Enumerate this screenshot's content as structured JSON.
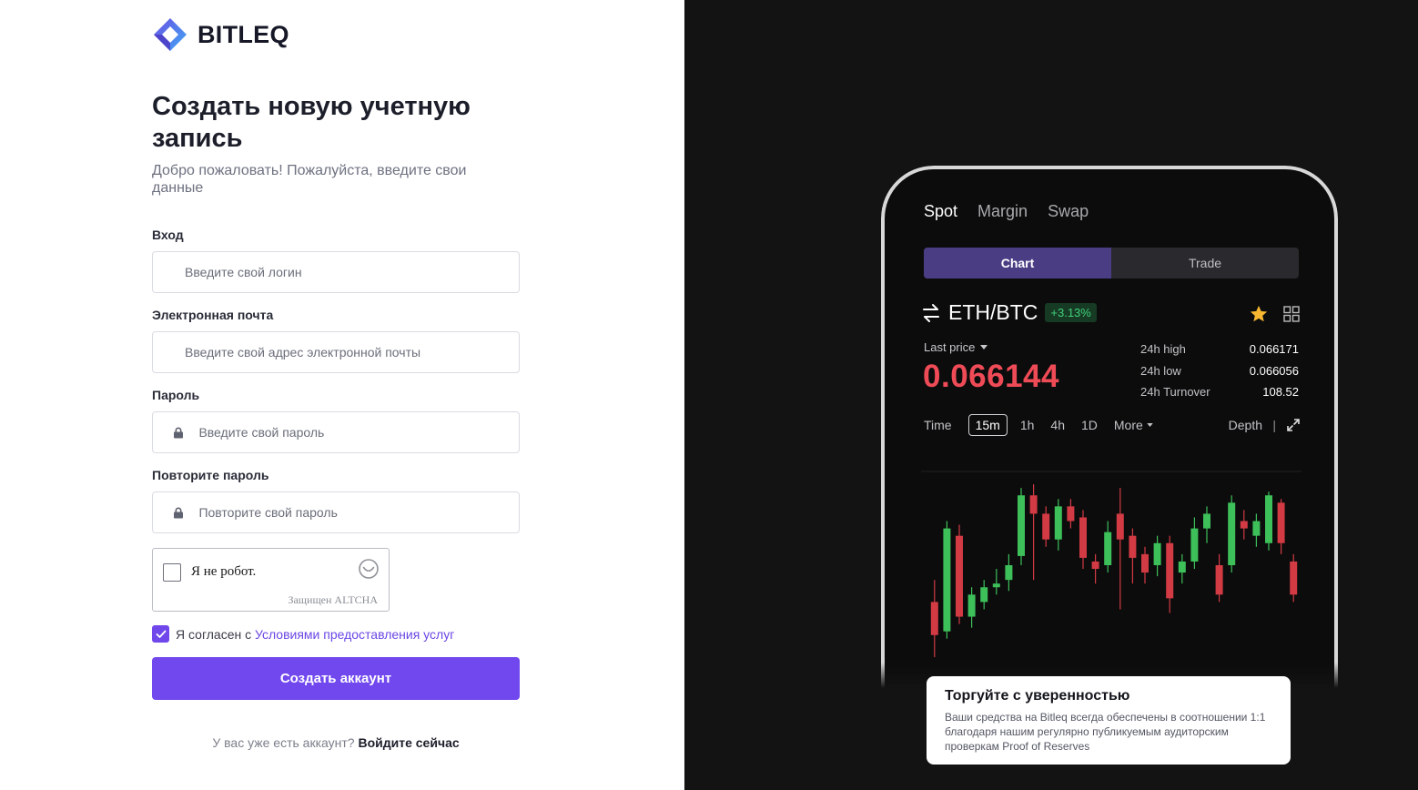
{
  "brand": {
    "name": "BITLEQ",
    "colors": {
      "accent": "#7147ee",
      "mark_top": "#6a4fe3",
      "mark_bottom": "#3fa9f5"
    }
  },
  "form": {
    "title": "Создать новую учетную запись",
    "subtitle": "Добро пожаловать! Пожалуйста, введите свои данные",
    "fields": [
      {
        "label": "Вход",
        "placeholder": "Введите свой логин",
        "icon": ""
      },
      {
        "label": "Электронная почта",
        "placeholder": "Введите свой адрес электронной почты",
        "icon": ""
      },
      {
        "label": "Пароль",
        "placeholder": "Введите свой пароль",
        "icon": "lock-icon"
      },
      {
        "label": "Повторите пароль",
        "placeholder": "Повторите свой пароль",
        "icon": "lock-icon"
      }
    ],
    "captcha": {
      "label": "Я не робот.",
      "footer": "Защищен ALTCHA",
      "checked": false
    },
    "agree": {
      "prefix": "Я согласен с ",
      "link": "Условиями предоставления услуг",
      "checked": true
    },
    "submit_label": "Создать аккаунт",
    "login": {
      "prompt": "У вас уже есть аккаунт?",
      "link": "Войдите сейчас"
    }
  },
  "promo": {
    "tabs": [
      {
        "label": "Spot",
        "active": true
      },
      {
        "label": "Margin",
        "active": false
      },
      {
        "label": "Swap",
        "active": false
      }
    ],
    "segment": [
      {
        "label": "Chart",
        "active": true
      },
      {
        "label": "Trade",
        "active": false
      }
    ],
    "pair": {
      "name": "ETH/BTC",
      "change": "+3.13%"
    },
    "last_price_label": "Last price",
    "last_price": "0.066144",
    "stats": [
      {
        "label": "24h high",
        "value": "0.066171"
      },
      {
        "label": "24h low",
        "value": "0.066056"
      },
      {
        "label": "24h Turnover",
        "value": "108.52"
      }
    ],
    "timeframes": {
      "time_label": "Time",
      "options": [
        "15m",
        "1h",
        "4h",
        "1D"
      ],
      "active": "15m",
      "more": "More",
      "depth": "Depth"
    },
    "colors": {
      "up": "#3dbf5a",
      "down": "#d23a44",
      "price": "#ef4b57"
    },
    "card": {
      "title": "Торгуйте с уверенностью",
      "text": "Ваши средства на Bitleq всегда обеспечены в соотношении 1:1 благодаря нашим регулярно публикуемым аудиторским проверкам Proof of Reserves"
    }
  },
  "chart_data": {
    "type": "candlestick",
    "candles": [
      {
        "o": 0.3,
        "c": 0.12,
        "h": 0.42,
        "l": 0.0
      },
      {
        "o": 0.14,
        "c": 0.7,
        "h": 0.74,
        "l": 0.1
      },
      {
        "o": 0.66,
        "c": 0.22,
        "h": 0.72,
        "l": 0.18
      },
      {
        "o": 0.22,
        "c": 0.34,
        "h": 0.38,
        "l": 0.16
      },
      {
        "o": 0.3,
        "c": 0.38,
        "h": 0.42,
        "l": 0.26
      },
      {
        "o": 0.38,
        "c": 0.4,
        "h": 0.48,
        "l": 0.34
      },
      {
        "o": 0.42,
        "c": 0.5,
        "h": 0.56,
        "l": 0.36
      },
      {
        "o": 0.55,
        "c": 0.88,
        "h": 0.92,
        "l": 0.5
      },
      {
        "o": 0.88,
        "c": 0.78,
        "h": 0.94,
        "l": 0.42
      },
      {
        "o": 0.78,
        "c": 0.64,
        "h": 0.82,
        "l": 0.6
      },
      {
        "o": 0.64,
        "c": 0.82,
        "h": 0.86,
        "l": 0.58
      },
      {
        "o": 0.82,
        "c": 0.74,
        "h": 0.86,
        "l": 0.7
      },
      {
        "o": 0.76,
        "c": 0.54,
        "h": 0.8,
        "l": 0.48
      },
      {
        "o": 0.52,
        "c": 0.48,
        "h": 0.56,
        "l": 0.4
      },
      {
        "o": 0.5,
        "c": 0.68,
        "h": 0.74,
        "l": 0.46
      },
      {
        "o": 0.78,
        "c": 0.64,
        "h": 0.92,
        "l": 0.26
      },
      {
        "o": 0.66,
        "c": 0.54,
        "h": 0.7,
        "l": 0.4
      },
      {
        "o": 0.56,
        "c": 0.46,
        "h": 0.6,
        "l": 0.4
      },
      {
        "o": 0.5,
        "c": 0.62,
        "h": 0.66,
        "l": 0.44
      },
      {
        "o": 0.62,
        "c": 0.32,
        "h": 0.66,
        "l": 0.24
      },
      {
        "o": 0.46,
        "c": 0.52,
        "h": 0.56,
        "l": 0.4
      },
      {
        "o": 0.52,
        "c": 0.7,
        "h": 0.76,
        "l": 0.48
      },
      {
        "o": 0.7,
        "c": 0.78,
        "h": 0.82,
        "l": 0.62
      },
      {
        "o": 0.5,
        "c": 0.34,
        "h": 0.56,
        "l": 0.3
      },
      {
        "o": 0.5,
        "c": 0.84,
        "h": 0.88,
        "l": 0.46
      },
      {
        "o": 0.74,
        "c": 0.7,
        "h": 0.8,
        "l": 0.64
      },
      {
        "o": 0.66,
        "c": 0.74,
        "h": 0.78,
        "l": 0.6
      },
      {
        "o": 0.62,
        "c": 0.88,
        "h": 0.9,
        "l": 0.58
      },
      {
        "o": 0.84,
        "c": 0.62,
        "h": 0.86,
        "l": 0.56
      },
      {
        "o": 0.52,
        "c": 0.34,
        "h": 0.56,
        "l": 0.3
      }
    ]
  }
}
